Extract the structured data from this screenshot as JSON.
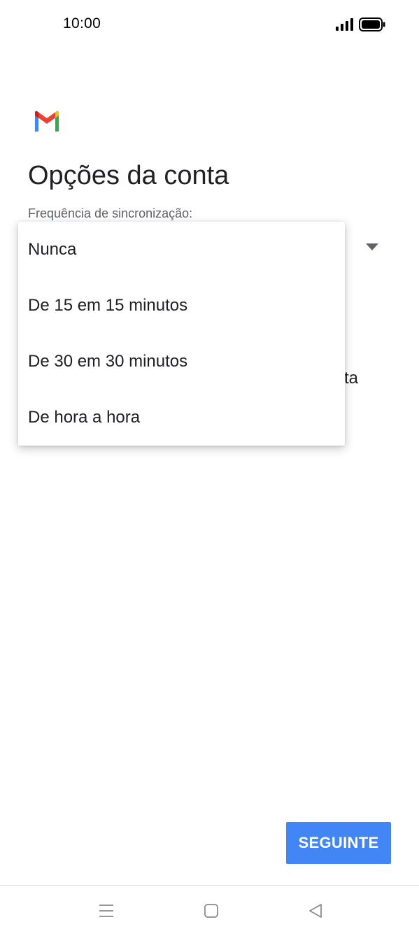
{
  "status_bar": {
    "time": "10:00",
    "signal_icon": "signal-icon",
    "battery_icon": "battery-icon"
  },
  "app": {
    "logo_icon": "gmail-icon",
    "title": "Opções da conta"
  },
  "sync_field": {
    "label": "Frequência de sincronização:"
  },
  "dropdown": {
    "options": [
      "Nunca",
      "De 15 em 15 minutos",
      "De 30 em 30 minutos",
      "De hora a hora"
    ]
  },
  "partially_hidden_text": "ta",
  "footer": {
    "next_label": "SEGUINTE"
  },
  "nav_bar": {
    "icons": [
      "menu-icon",
      "home-icon",
      "back-icon"
    ]
  },
  "colors": {
    "primary_button": "#4285f4",
    "text_primary": "#202124",
    "text_secondary": "#5f6368"
  }
}
